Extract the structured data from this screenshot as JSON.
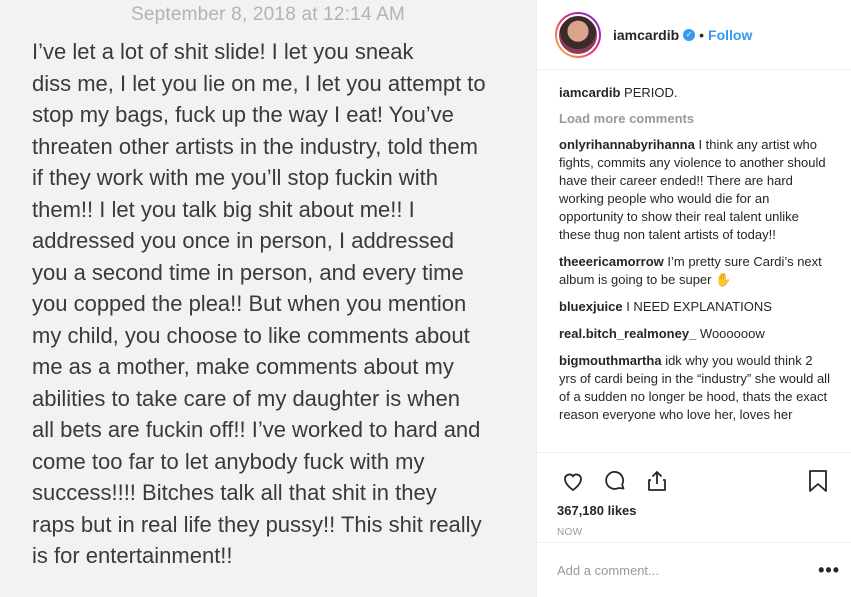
{
  "photo": {
    "date": "September 8, 2018 at 12:14 AM",
    "text": "I’ve let a lot of shit slide! I let you sneak\ndiss me, I let you lie on me, I let you attempt to\nstop my bags, fuck up the way I eat! You’ve\nthreaten other artists in the industry, told them\nif they work with me you’ll stop fuckin with\nthem!! I let you talk big shit about me!! I\naddressed you once in person, I addressed\nyou a second time in person, and every time\nyou copped the plea!! But when you mention\nmy child, you choose to like comments about\nme as a mother, make comments about my\nabilities to take care of my daughter is when\nall bets are fuckin off!! I’ve worked to hard and\ncome too far to let anybody fuck with my\nsuccess!!!! Bitches talk all that shit in they\nraps but in real life they pussy!! This shit really\nis for entertainment!!"
  },
  "header": {
    "username": "iamcardib",
    "verified_icon": "verified-badge-icon",
    "dot": "•",
    "follow_label": "Follow"
  },
  "caption": {
    "username": "iamcardib",
    "text": "PERIOD."
  },
  "load_more_label": "Load more comments",
  "comments": [
    {
      "username": "onlyrihannabyrihanna",
      "text": "I think any artist who fights, commits any violence to another should have their career ended!! There are hard working people who would die for an opportunity to show their real talent unlike these thug non talent artists of today!!"
    },
    {
      "username": "theeericamorrow",
      "text": "I’m pretty sure Cardi’s next album is going to be super ✋"
    },
    {
      "username": "bluexjuice",
      "text": "I NEED EXPLANATIONS"
    },
    {
      "username": "real.bitch_realmoney_",
      "text": "Woooooow"
    },
    {
      "username": "bigmouthmartha",
      "text": "idk why you would think 2 yrs of cardi being in the “industry” she would all of a sudden no longer be hood, thats the exact reason everyone who love her, loves her"
    }
  ],
  "actions": {
    "like_icon": "heart-icon",
    "comment_icon": "comment-bubble-icon",
    "share_icon": "share-icon",
    "save_icon": "bookmark-icon",
    "likes": "367,180 likes",
    "time": "NOW"
  },
  "add_comment": {
    "placeholder": "Add a comment...",
    "more_label": "•••"
  },
  "colors": {
    "accent": "#3897f0",
    "muted": "#999999",
    "text": "#262626"
  }
}
